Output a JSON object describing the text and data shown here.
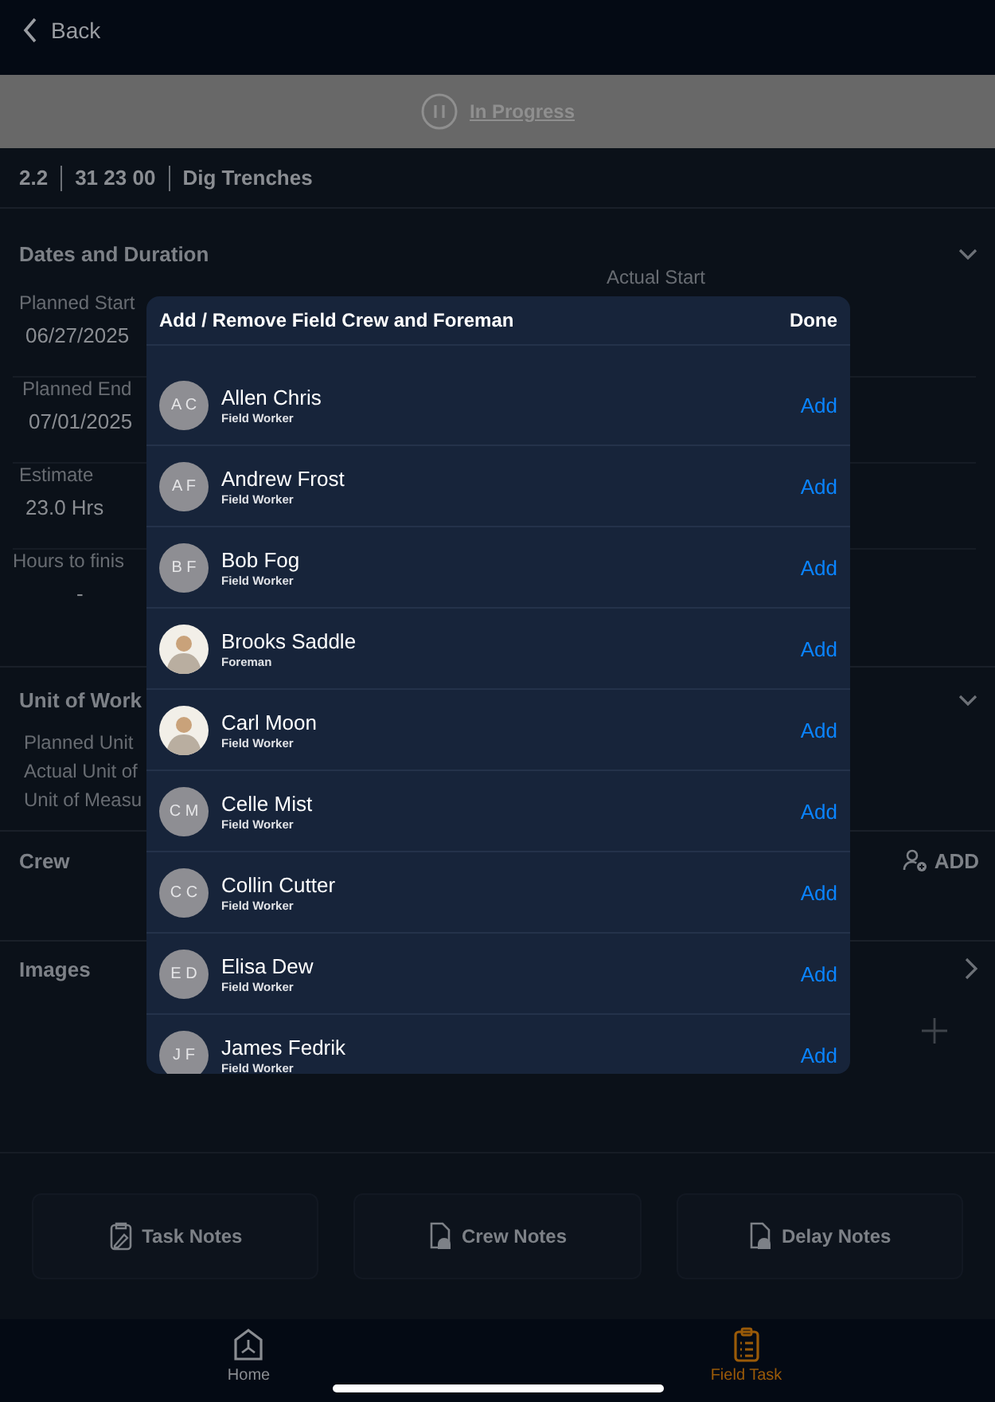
{
  "nav": {
    "back": "Back"
  },
  "status": {
    "label": "In Progress"
  },
  "task": {
    "parts": [
      "2.2",
      "31 23 00",
      "Dig Trenches"
    ]
  },
  "dates": {
    "title": "Dates and Duration",
    "expanded": true,
    "fields": [
      {
        "label": "Planned Start",
        "value": "06/27/2025",
        "right_label": "Actual Start"
      },
      {
        "label": "Planned End",
        "value": "07/01/2025"
      },
      {
        "label": "Estimate",
        "value": "23.0 Hrs"
      },
      {
        "label": "Hours to finis",
        "value": "-"
      }
    ]
  },
  "unit_of_work": {
    "title": "Unit of Work",
    "expanded": true,
    "lines": [
      "Planned Unit",
      "Actual Unit of",
      "Unit of Measu"
    ]
  },
  "crew": {
    "title": "Crew",
    "add": "ADD"
  },
  "images": {
    "title": "Images"
  },
  "notes": [
    "Task Notes",
    "Crew Notes",
    "Delay Notes"
  ],
  "modal": {
    "title": "Add / Remove Field Crew and Foreman",
    "done": "Done",
    "people": [
      {
        "kind": "initials",
        "initials": "A C",
        "name": "Allen Chris",
        "role": "Field Worker",
        "action": "Add"
      },
      {
        "kind": "initials",
        "initials": "A F",
        "name": "Andrew Frost",
        "role": "Field Worker",
        "action": "Add"
      },
      {
        "kind": "initials",
        "initials": "B F",
        "name": "Bob Fog",
        "role": "Field Worker",
        "action": "Add"
      },
      {
        "kind": "photo",
        "name": "Brooks Saddle",
        "role": "Foreman",
        "action": "Add"
      },
      {
        "kind": "photo",
        "name": "Carl Moon",
        "role": "Field Worker",
        "action": "Add"
      },
      {
        "kind": "initials",
        "initials": "C M",
        "name": "Celle Mist",
        "role": "Field Worker",
        "action": "Add"
      },
      {
        "kind": "initials",
        "initials": "C C",
        "name": "Collin Cutter",
        "role": "Field Worker",
        "action": "Add"
      },
      {
        "kind": "initials",
        "initials": "E D",
        "name": "Elisa Dew",
        "role": "Field Worker",
        "action": "Add"
      },
      {
        "kind": "initials",
        "initials": "J F",
        "name": "James Fedrik",
        "role": "Field Worker",
        "action": "Add"
      }
    ]
  },
  "tabs": [
    {
      "label": "Home",
      "selected": false
    },
    {
      "label": "Field Task",
      "selected": true
    }
  ]
}
